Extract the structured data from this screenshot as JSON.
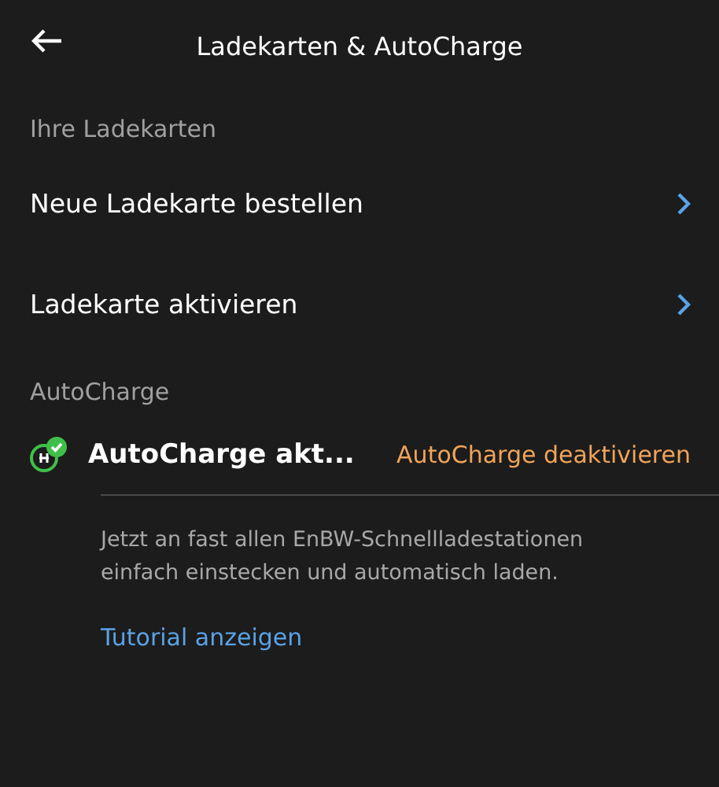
{
  "header": {
    "title": "Ladekarten & AutoCharge"
  },
  "sections": [
    {
      "title": "Ihre Ladekarten",
      "items": [
        {
          "label": "Neue Ladekarte bestellen"
        },
        {
          "label": "Ladekarte aktivieren"
        }
      ]
    },
    {
      "title": "AutoCharge"
    }
  ],
  "autocharge": {
    "status": "AutoCharge akt...",
    "action": "AutoCharge deaktivieren",
    "description": "Jetzt an fast allen EnBW-Schnellladestationen einfach einstecken und automatisch laden.",
    "link": "Tutorial anzeigen"
  }
}
